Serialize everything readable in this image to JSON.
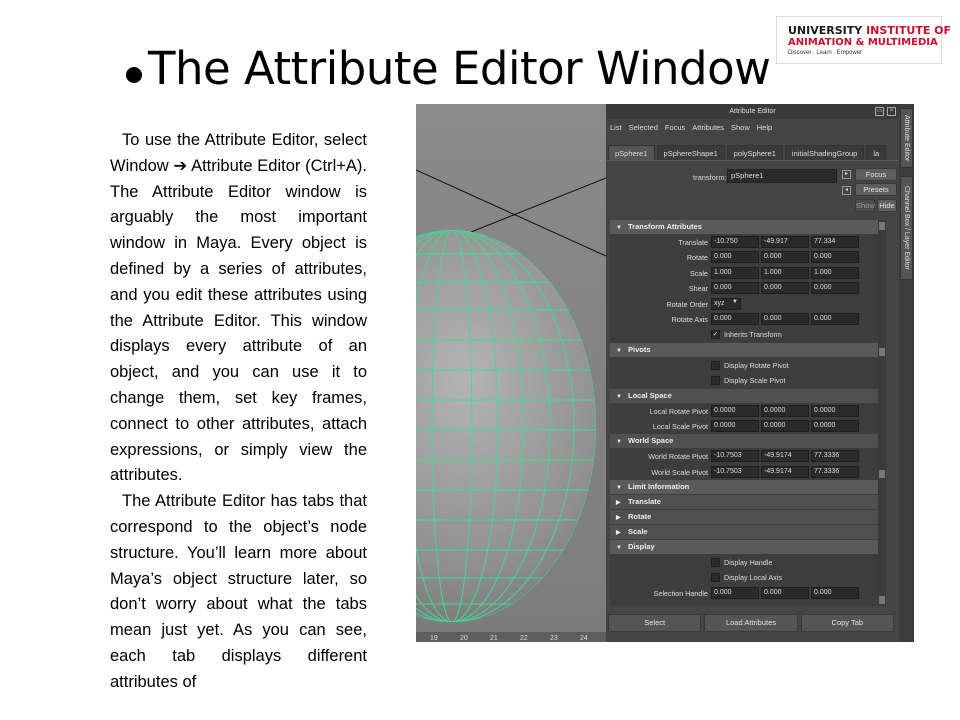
{
  "slide": {
    "title": "The Attribute Editor Window",
    "paragraphs": [
      "To use the Attribute Editor, select Window ➔ Attribute Editor (Ctrl+A). The Attribute Editor window is arguably the most important window in Maya. Every object is defined by a series of attributes, and you edit these attributes using the Attribute Editor. This window displays every attribute of an object, and you can use it to change them, set key frames, connect to other attributes, attach expressions, or simply view the attributes.",
      "The Attribute Editor has tabs that correspond to the object’s node structure. You’ll learn more about Maya’s object structure later, so don’t worry about what the tabs mean just yet. As you can see, each tab displays different attributes of"
    ]
  },
  "logo": {
    "line1_a": "UNIVERSITY",
    "line1_b": "INSTITUTE OF",
    "line2": "ANIMATION & MULTIMEDIA",
    "line3": "Discover . Learn . Empower",
    "seal_text": "CU"
  },
  "viewport": {
    "ruler_ticks": [
      "19",
      "20",
      "21",
      "22",
      "23",
      "24"
    ],
    "wire_color": "#3ddc97"
  },
  "attribute_editor": {
    "window_title": "Attribute Editor",
    "menu": [
      "List",
      "Selected",
      "Focus",
      "Attributes",
      "Show",
      "Help"
    ],
    "tabs": [
      "pSphere1",
      "pSphereShape1",
      "polySphere1",
      "initialShadingGroup",
      "la"
    ],
    "transform_label": "transform:",
    "transform_value": "pSphere1",
    "buttons": {
      "focus": "Focus",
      "presets": "Presets",
      "show": "Show",
      "hide": "Hide"
    },
    "transform_section": "Transform Attributes",
    "translate": {
      "label": "Translate",
      "values": [
        "-10.750",
        "-49.917",
        "77.334"
      ]
    },
    "rotate": {
      "label": "Rotate",
      "values": [
        "0.000",
        "0.000",
        "0.000"
      ]
    },
    "scale": {
      "label": "Scale",
      "values": [
        "1.000",
        "1.000",
        "1.000"
      ]
    },
    "shear": {
      "label": "Shear",
      "values": [
        "0.000",
        "0.000",
        "0.000"
      ]
    },
    "rotate_order": {
      "label": "Rotate Order",
      "value": "xyz"
    },
    "rotate_axis": {
      "label": "Rotate Axis",
      "values": [
        "0.000",
        "0.000",
        "0.000"
      ]
    },
    "inherits_transform": "Inherits Transform",
    "pivots_section": "Pivots",
    "display_rotate_pivot": "Display Rotate Pivot",
    "display_scale_pivot": "Display Scale Pivot",
    "local_space_section": "Local Space",
    "local_rotate_pivot": {
      "label": "Local Rotate Pivot",
      "values": [
        "0.0000",
        "0.0000",
        "0.0000"
      ]
    },
    "local_scale_pivot": {
      "label": "Local Scale Pivot",
      "values": [
        "0.0000",
        "0.0000",
        "0.0000"
      ]
    },
    "world_space_section": "World Space",
    "world_rotate_pivot": {
      "label": "World Rotate Pivot",
      "values": [
        "-10.7503",
        "-49.9174",
        "77.3336"
      ]
    },
    "world_scale_pivot": {
      "label": "World Scale Pivot",
      "values": [
        "-10.7503",
        "-49.9174",
        "77.3336"
      ]
    },
    "limit_section": "Limit Information",
    "limit_translate": "Translate",
    "limit_rotate": "Rotate",
    "limit_scale": "Scale",
    "display_section": "Display",
    "display_handle": "Display Handle",
    "display_local_axis": "Display Local Axis",
    "selection_handle": {
      "label": "Selection Handle",
      "values": [
        "0.000",
        "0.000",
        "0.000"
      ]
    },
    "bottom_buttons": [
      "Select",
      "Load Attributes",
      "Copy Tab"
    ],
    "side_tabs": [
      "Attribute Editor",
      "Channel Box / Layer Editor"
    ]
  }
}
